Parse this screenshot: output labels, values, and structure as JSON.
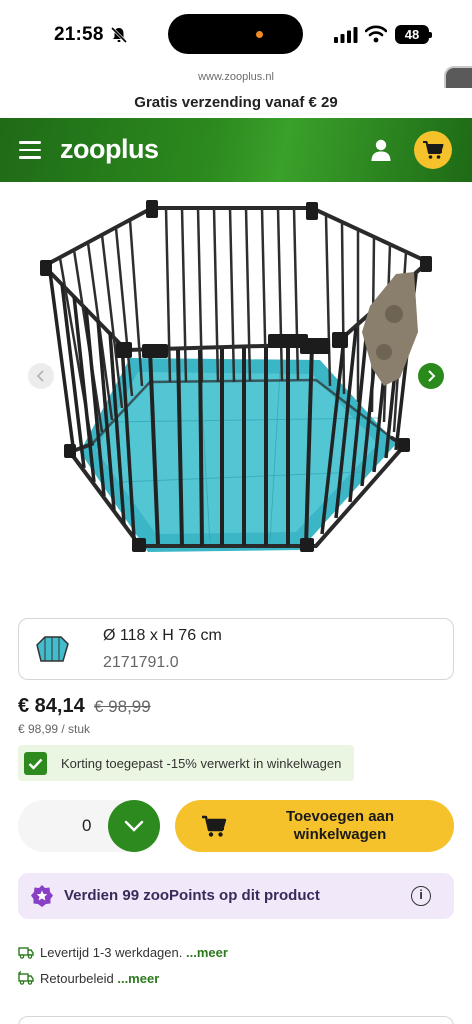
{
  "status_bar": {
    "time": "21:58",
    "battery": "48"
  },
  "browser": {
    "url": "www.zooplus.nl"
  },
  "promo_banner": {
    "text": "Gratis verzending vanaf € 29"
  },
  "header": {
    "logo": "zooplus"
  },
  "icons": {
    "menu": "hamburger-icon",
    "account": "user-icon",
    "cart": "cart-icon",
    "prev": "chevron-left-icon",
    "next": "chevron-right-icon",
    "points": "star-badge-icon",
    "info": "info-icon",
    "delivery": "truck-icon",
    "returns": "return-truck-icon"
  },
  "colors": {
    "brand_green": "#2c8a1e",
    "accent_yellow": "#f6c22b",
    "points_bg": "#f1e9fa",
    "discount_bg": "#eaf6e2"
  },
  "product": {
    "variant": {
      "size": "Ø 118 x H 76 cm",
      "code": "2171791.0"
    },
    "price": "€ 84,14",
    "old_price": "€ 98,99",
    "unit_price": "€ 98,99 / stuk",
    "discount_text": "Korting toegepast -15% verwerkt in winkelwagen"
  },
  "purchase": {
    "quantity": "0",
    "add_to_cart_label": "Toevoegen aan winkelwagen"
  },
  "points": {
    "text": "Verdien 99 zooPoints op dit product",
    "info": "i"
  },
  "shipping": {
    "delivery_text": "Levertijd 1-3 werkdagen.",
    "returns_text": "Retourbeleid",
    "more_label": "...meer"
  }
}
